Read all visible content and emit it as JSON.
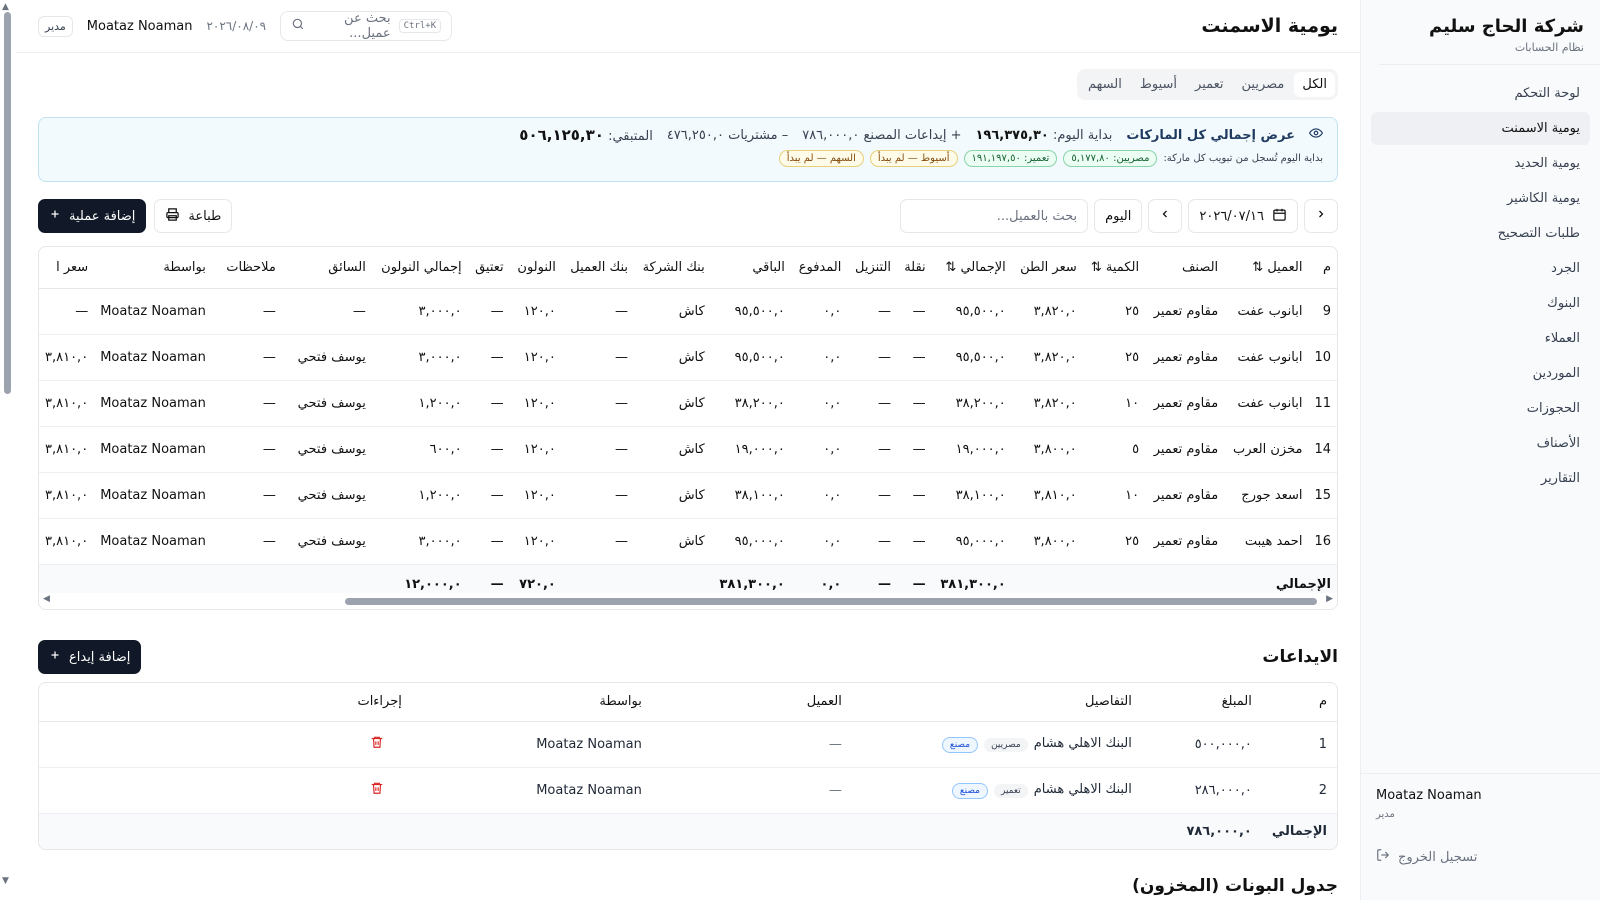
{
  "sidebar": {
    "brand": "شركة الحاج سليم",
    "subtitle": "نظام الحسابات",
    "items": [
      "لوحة التحكم",
      "يومية الاسمنت",
      "يومية الحديد",
      "يومية الكاشير",
      "طلبات التصحيح",
      "الجرد",
      "البنوك",
      "العملاء",
      "الموردين",
      "الحجوزات",
      "الأصناف",
      "التقارير"
    ],
    "user_name": "Moataz Noaman",
    "user_role": "مدير",
    "logout": "تسجيل الخروج"
  },
  "header": {
    "title": "يومية الاسمنت",
    "role": "مدير",
    "user": "Moataz Noaman",
    "date": "٢٠٢٦/٠٨/٠٩",
    "search_placeholder": "بحث عن عميل...",
    "shortcut": "Ctrl+K"
  },
  "tabs": [
    "الكل",
    "مصريين",
    "تعمير",
    "أسيوط",
    "السهم"
  ],
  "summary": {
    "title": "عرض إجمالي كل الماركات",
    "start_label": "بداية اليوم:",
    "start_value": "١٩٦,٣٧٥,٣٠",
    "deposits": "+ إيداعات المصنع ٧٨٦,٠٠٠,٠",
    "purchases": "– مشتريات ٤٧٦,٢٥٠,٠",
    "remaining_label": "المتبقي:",
    "remaining_value": "٥٠٦,١٢٥,٣٠",
    "note": "بداية اليوم تُسجل من تبويب كل ماركة:",
    "chips": [
      {
        "text": "مصريين: ٥,١٧٧,٨٠",
        "style": "green"
      },
      {
        "text": "تعمير: ١٩١,١٩٧,٥٠",
        "style": "green"
      },
      {
        "text": "أسيوط — لم يبدأ",
        "style": "yellow"
      },
      {
        "text": "السهم — لم يبدأ",
        "style": "yellow"
      }
    ]
  },
  "toolbar": {
    "date": "٢٠٢٦/٠٧/١٦",
    "today": "اليوم",
    "client_search": "بحث بالعميل...",
    "print": "طباعة",
    "add_op": "إضافة عملية"
  },
  "ops_table": {
    "headers": [
      "م",
      "العميل",
      "الصنف",
      "الكمية",
      "سعر الطن",
      "الإجمالي",
      "نقلة",
      "التنزيل",
      "المدفوع",
      "الباقي",
      "بنك الشركة",
      "بنك العميل",
      "النولون",
      "تعتيق",
      "إجمالي النولون",
      "السائق",
      "ملاحظات",
      "بواسطة",
      "سعر ا"
    ],
    "rows": [
      [
        "9",
        "ابانوب عفت",
        "مقاوم تعمير",
        "٢٥",
        "٣,٨٢٠,٠",
        "٩٥,٥٠٠,٠",
        "—",
        "—",
        "٠,٠",
        "٩٥,٥٠٠,٠",
        "كاش",
        "—",
        "١٢٠,٠",
        "—",
        "٣,٠٠٠,٠",
        "—",
        "—",
        "Moataz Noaman",
        "—"
      ],
      [
        "10",
        "ابانوب عفت",
        "مقاوم تعمير",
        "٢٥",
        "٣,٨٢٠,٠",
        "٩٥,٥٠٠,٠",
        "—",
        "—",
        "٠,٠",
        "٩٥,٥٠٠,٠",
        "كاش",
        "—",
        "١٢٠,٠",
        "—",
        "٣,٠٠٠,٠",
        "يوسف فتحي",
        "—",
        "Moataz Noaman",
        "٣,٨١٠,٠"
      ],
      [
        "11",
        "ابانوب عفت",
        "مقاوم تعمير",
        "١٠",
        "٣,٨٢٠,٠",
        "٣٨,٢٠٠,٠",
        "—",
        "—",
        "٠,٠",
        "٣٨,٢٠٠,٠",
        "كاش",
        "—",
        "١٢٠,٠",
        "—",
        "١,٢٠٠,٠",
        "يوسف فتحي",
        "—",
        "Moataz Noaman",
        "٣,٨١٠,٠"
      ],
      [
        "14",
        "مخزن العرب",
        "مقاوم تعمير",
        "٥",
        "٣,٨٠٠,٠",
        "١٩,٠٠٠,٠",
        "—",
        "—",
        "٠,٠",
        "١٩,٠٠٠,٠",
        "كاش",
        "—",
        "١٢٠,٠",
        "—",
        "٦٠٠,٠",
        "يوسف فتحي",
        "—",
        "Moataz Noaman",
        "٣,٨١٠,٠"
      ],
      [
        "15",
        "اسعد جورج",
        "مقاوم تعمير",
        "١٠",
        "٣,٨١٠,٠",
        "٣٨,١٠٠,٠",
        "—",
        "—",
        "٠,٠",
        "٣٨,١٠٠,٠",
        "كاش",
        "—",
        "١٢٠,٠",
        "—",
        "١,٢٠٠,٠",
        "يوسف فتحي",
        "—",
        "Moataz Noaman",
        "٣,٨١٠,٠"
      ],
      [
        "16",
        "احمد هيبت",
        "مقاوم تعمير",
        "٢٥",
        "٣,٨٠٠,٠",
        "٩٥,٠٠٠,٠",
        "—",
        "—",
        "٠,٠",
        "٩٥,٠٠٠,٠",
        "كاش",
        "—",
        "١٢٠,٠",
        "—",
        "٣,٠٠٠,٠",
        "يوسف فتحي",
        "—",
        "Moataz Noaman",
        "٣,٨١٠,٠"
      ]
    ],
    "total_label": "الإجمالي",
    "total_sum": "٣٨١,٣٠٠,٠",
    "total_naqla": "—",
    "total_tanzeel": "—",
    "total_paid": "٠,٠",
    "total_remaining": "٣٨١,٣٠٠,٠",
    "total_nawlon": "٧٢٠,٠",
    "total_ta3teeq": "—",
    "total_nawlon_sum": "١٢,٠٠٠,٠"
  },
  "deposits": {
    "title": "الايداعات",
    "add": "إضافة إيداع",
    "headers": [
      "م",
      "المبلغ",
      "التفاصيل",
      "العميل",
      "بواسطة",
      "إجراءات"
    ],
    "rows": [
      {
        "n": "1",
        "amount": "٥٠٠,٠٠٠,٠",
        "details": "البنك الاهلي هشام",
        "brand": "مصريين",
        "tag": "مصنع",
        "client": "—",
        "by": "Moataz Noaman"
      },
      {
        "n": "2",
        "amount": "٢٨٦,٠٠٠,٠",
        "details": "البنك الاهلي هشام",
        "brand": "تعمير",
        "tag": "مصنع",
        "client": "—",
        "by": "Moataz Noaman"
      }
    ],
    "total_label": "الإجمالي",
    "total_value": "٧٨٦,٠٠٠,٠"
  },
  "coupons_title": "جدول البونات (المخزون)"
}
